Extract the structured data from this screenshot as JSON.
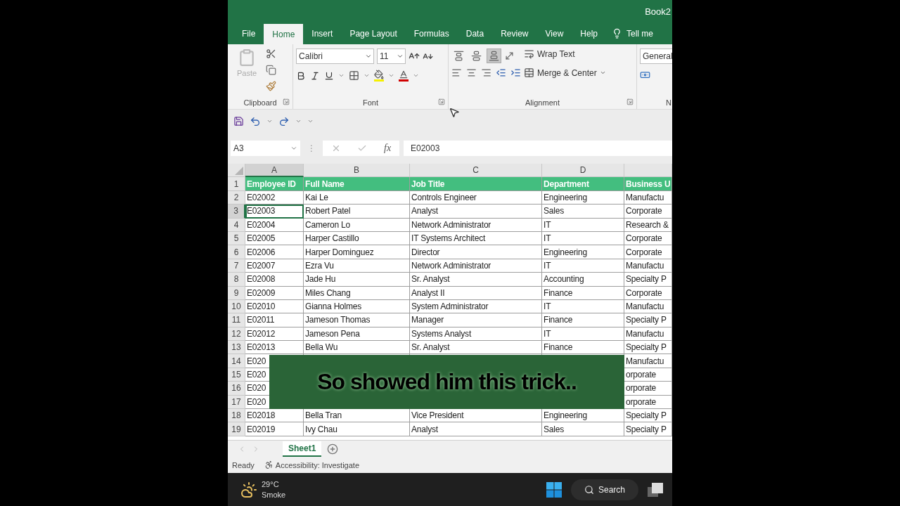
{
  "window": {
    "title": "Book2"
  },
  "ribbon_tabs": [
    {
      "label": "File",
      "selected": false
    },
    {
      "label": "Home",
      "selected": true
    },
    {
      "label": "Insert",
      "selected": false
    },
    {
      "label": "Page Layout",
      "selected": false
    },
    {
      "label": "Formulas",
      "selected": false
    },
    {
      "label": "Data",
      "selected": false
    },
    {
      "label": "Review",
      "selected": false
    },
    {
      "label": "View",
      "selected": false
    },
    {
      "label": "Help",
      "selected": false
    }
  ],
  "tell_me": "Tell me",
  "ribbon": {
    "paste": "Paste",
    "font_name": "Calibri",
    "font_size": "11",
    "vertical_align": [
      {
        "selected": false
      },
      {
        "selected": false
      },
      {
        "selected": true
      }
    ],
    "wrap_text": "Wrap Text",
    "merge_center": "Merge & Center",
    "number_format": "General",
    "groups": [
      "Clipboard",
      "Font",
      "Alignment",
      "N"
    ]
  },
  "formula_bar": {
    "name_box": "A3",
    "splitter": "⋮",
    "function_label": "fx",
    "value": "E02003"
  },
  "columns": [
    {
      "label": "A",
      "selected": true
    },
    {
      "label": "B",
      "selected": false
    },
    {
      "label": "C",
      "selected": false
    },
    {
      "label": "D",
      "selected": false
    }
  ],
  "rows": [
    {
      "number": "1",
      "kind": "header",
      "selected": false,
      "cells": [
        "Employee ID",
        "Full Name",
        "Job Title",
        "Department",
        "Business U"
      ]
    },
    {
      "number": "2",
      "kind": "data",
      "selected": false,
      "cells": [
        "E02002",
        "Kai Le",
        "Controls Engineer",
        "Engineering",
        "Manufactu"
      ]
    },
    {
      "number": "3",
      "kind": "data",
      "selected": true,
      "cells": [
        "E02003",
        "Robert Patel",
        "Analyst",
        "Sales",
        "Corporate"
      ]
    },
    {
      "number": "4",
      "kind": "data",
      "selected": false,
      "cells": [
        "E02004",
        "Cameron Lo",
        "Network Administrator",
        "IT",
        "Research &"
      ]
    },
    {
      "number": "5",
      "kind": "data",
      "selected": false,
      "cells": [
        "E02005",
        "Harper Castillo",
        "IT Systems Architect",
        "IT",
        "Corporate"
      ]
    },
    {
      "number": "6",
      "kind": "data",
      "selected": false,
      "cells": [
        "E02006",
        "Harper Dominguez",
        "Director",
        "Engineering",
        "Corporate"
      ]
    },
    {
      "number": "7",
      "kind": "data",
      "selected": false,
      "cells": [
        "E02007",
        "Ezra Vu",
        "Network Administrator",
        "IT",
        "Manufactu"
      ]
    },
    {
      "number": "8",
      "kind": "data",
      "selected": false,
      "cells": [
        "E02008",
        "Jade Hu",
        "Sr. Analyst",
        "Accounting",
        "Specialty P"
      ]
    },
    {
      "number": "9",
      "kind": "data",
      "selected": false,
      "cells": [
        "E02009",
        "Miles Chang",
        "Analyst II",
        "Finance",
        "Corporate"
      ]
    },
    {
      "number": "10",
      "kind": "data",
      "selected": false,
      "cells": [
        "E02010",
        "Gianna Holmes",
        "System Administrator",
        "IT",
        "Manufactu"
      ]
    },
    {
      "number": "11",
      "kind": "data",
      "selected": false,
      "cells": [
        "E02011",
        "Jameson Thomas",
        "Manager",
        "Finance",
        "Specialty P"
      ]
    },
    {
      "number": "12",
      "kind": "data",
      "selected": false,
      "cells": [
        "E02012",
        "Jameson Pena",
        "Systems Analyst",
        "IT",
        "Manufactu"
      ]
    },
    {
      "number": "13",
      "kind": "data",
      "selected": false,
      "cells": [
        "E02013",
        "Bella Wu",
        "Sr. Analyst",
        "Finance",
        "Specialty P"
      ]
    },
    {
      "number": "14",
      "kind": "data",
      "selected": false,
      "cells": [
        "E020",
        null,
        null,
        null,
        "Manufactu"
      ]
    },
    {
      "number": "15",
      "kind": "data",
      "selected": false,
      "cells": [
        "E020",
        null,
        null,
        null,
        "orporate"
      ]
    },
    {
      "number": "16",
      "kind": "data",
      "selected": false,
      "cells": [
        "E020",
        null,
        null,
        null,
        "orporate"
      ]
    },
    {
      "number": "17",
      "kind": "data",
      "selected": false,
      "cells": [
        "E020",
        null,
        null,
        null,
        "orporate"
      ]
    },
    {
      "number": "18",
      "kind": "data",
      "selected": false,
      "cells": [
        "E02018",
        "Bella Tran",
        "Vice President",
        "Engineering",
        "Specialty P"
      ]
    },
    {
      "number": "19",
      "kind": "data",
      "selected": false,
      "cells": [
        "E02019",
        "Ivy Chau",
        "Analyst",
        "Sales",
        "Specialty P"
      ]
    }
  ],
  "caption": "So showed him this trick..",
  "sheet_tabs": [
    {
      "label": "Sheet1",
      "selected": true
    }
  ],
  "status": {
    "mode": "Ready",
    "accessibility": "Accessibility: Investigate"
  },
  "taskbar": {
    "temperature": "29°C",
    "weather": "Smoke",
    "search": "Search"
  }
}
